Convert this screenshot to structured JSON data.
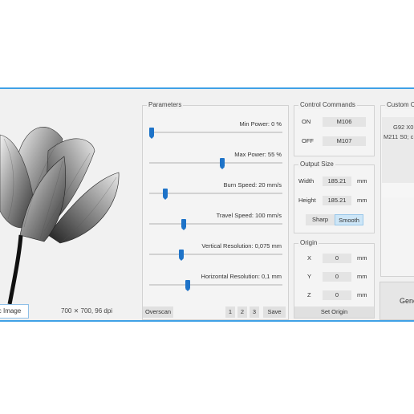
{
  "image_panel": {
    "open_button_label": "c Image",
    "image_info": "700 ⨯ 700, 96 dpi"
  },
  "parameters": {
    "title": "Parameters",
    "sliders": [
      {
        "label": "Min Power: 0 %",
        "value_fraction": 0.02
      },
      {
        "label": "Max Power: 55 %",
        "value_fraction": 0.55
      },
      {
        "label": "Burn Speed: 20 mm/s",
        "value_fraction": 0.12
      },
      {
        "label": "Travel Speed: 100 mm/s",
        "value_fraction": 0.26
      },
      {
        "label": "Vertical Resolution: 0,075 mm",
        "value_fraction": 0.24
      },
      {
        "label": "Horizontal Resolution: 0,1 mm",
        "value_fraction": 0.29
      }
    ],
    "overscan_label": "Overscan",
    "preset_buttons": [
      "1",
      "2",
      "3"
    ],
    "save_label": "Save"
  },
  "control_commands": {
    "title": "Control Commands",
    "on_label": "ON",
    "on_value": "M106",
    "off_label": "OFF",
    "off_value": "M107"
  },
  "output_size": {
    "title": "Output Size",
    "width_label": "Width",
    "width_value": "185.21",
    "width_unit": "mm",
    "height_label": "Height",
    "height_value": "185.21",
    "height_unit": "mm",
    "sharp_label": "Sharp",
    "smooth_label": "Smooth",
    "selected": "Smooth"
  },
  "origin": {
    "title": "Origin",
    "x_label": "X",
    "x_value": "0",
    "y_label": "Y",
    "y_value": "0",
    "z_label": "Z",
    "z_value": "0",
    "unit": "mm",
    "set_origin_label": "Set Origin"
  },
  "custom_commands": {
    "title": "Custom Co",
    "lines": [
      "G92 X0",
      "M211 S0; c"
    ]
  },
  "generate_label": "Gene",
  "colors": {
    "accent": "#3fa1e6",
    "slider_thumb": "#1e73c8",
    "smooth_selected": "#cde6f7"
  }
}
